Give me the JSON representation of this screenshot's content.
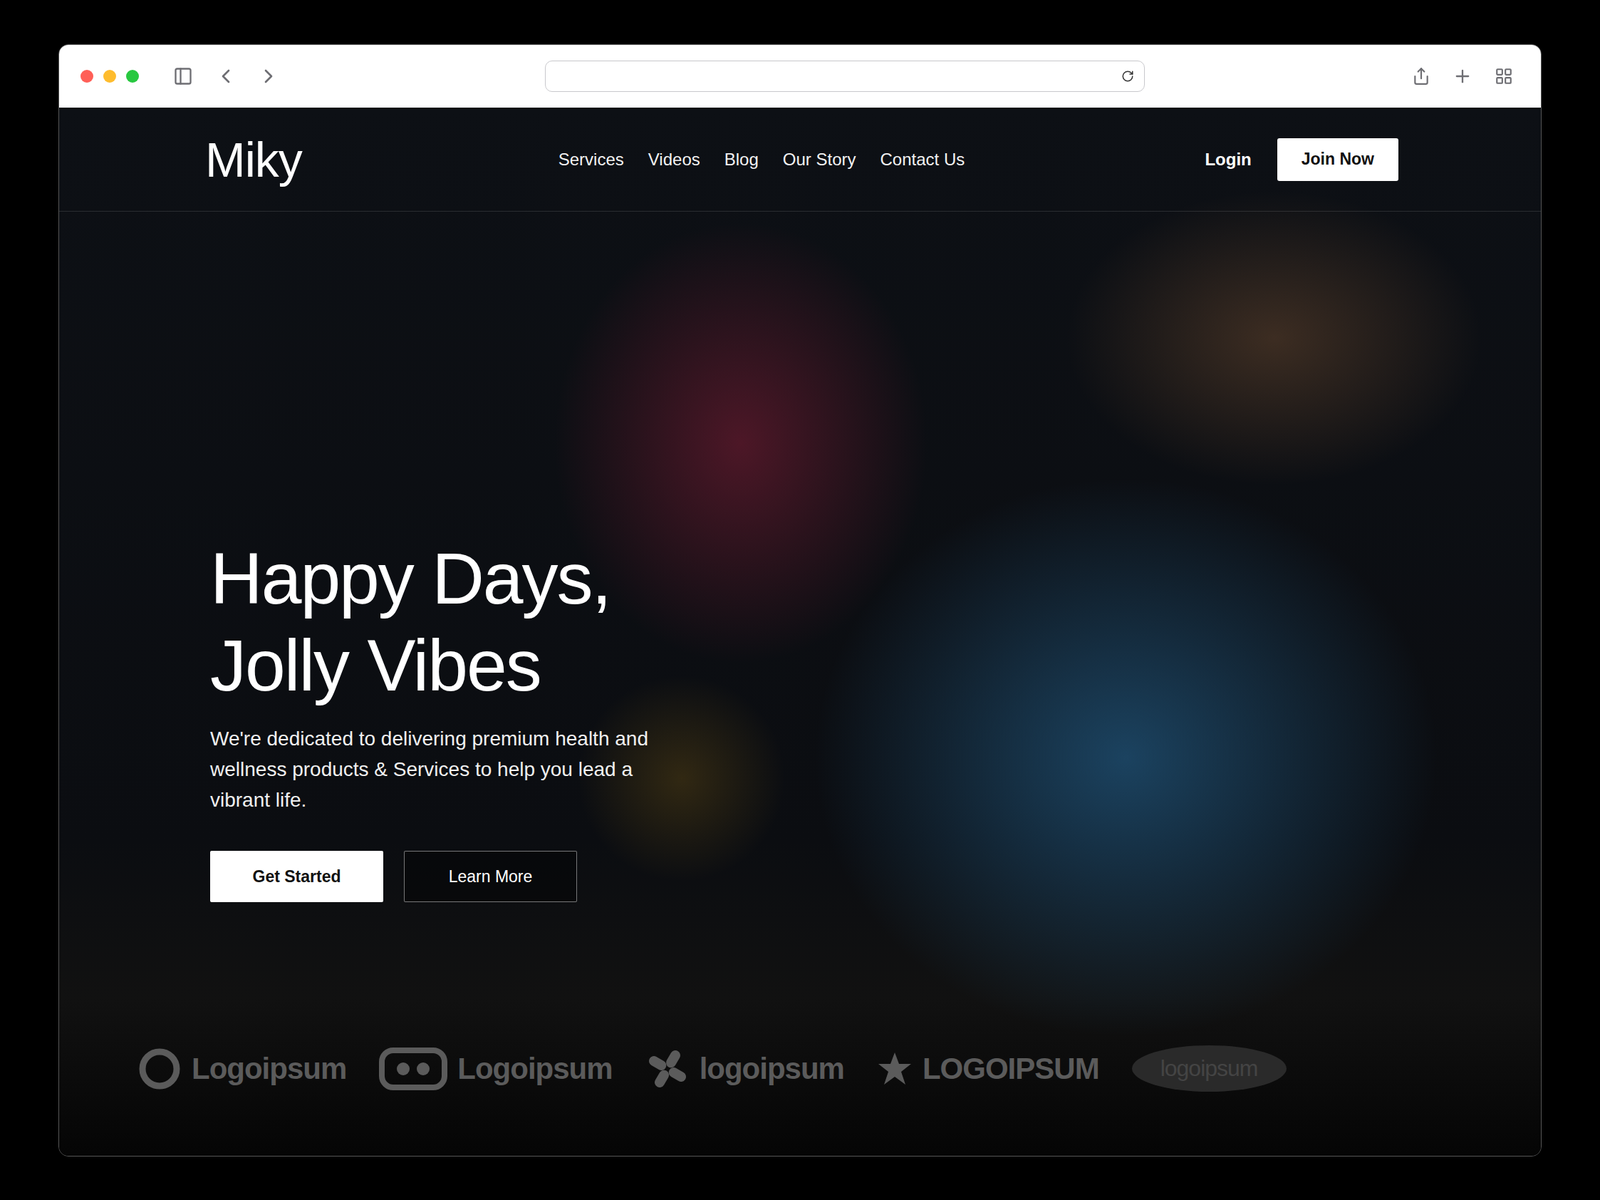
{
  "browser": {
    "address": ""
  },
  "site": {
    "logo": "Miky",
    "nav": [
      {
        "label": "Services"
      },
      {
        "label": "Videos"
      },
      {
        "label": "Blog"
      },
      {
        "label": "Our Story"
      },
      {
        "label": "Contact Us"
      }
    ],
    "login": "Login",
    "join": "Join Now"
  },
  "hero": {
    "title_lines": [
      "Happy Days,",
      "Jolly Vibes"
    ],
    "subtitle": "We're dedicated to delivering premium health and wellness products & Services to help you lead a vibrant life.",
    "buttons": [
      {
        "label": "Get Started",
        "kind": "solid"
      },
      {
        "label": "Learn More",
        "kind": "outline"
      }
    ]
  },
  "logos": [
    {
      "label": "Logoipsum",
      "kind": "ring"
    },
    {
      "label": "Logoipsum",
      "kind": "pill"
    },
    {
      "label": "logoipsum",
      "kind": "petals"
    },
    {
      "label": "LOGOIPSUM",
      "kind": "star"
    },
    {
      "label": "logoipsum",
      "kind": "ellipse"
    }
  ]
}
